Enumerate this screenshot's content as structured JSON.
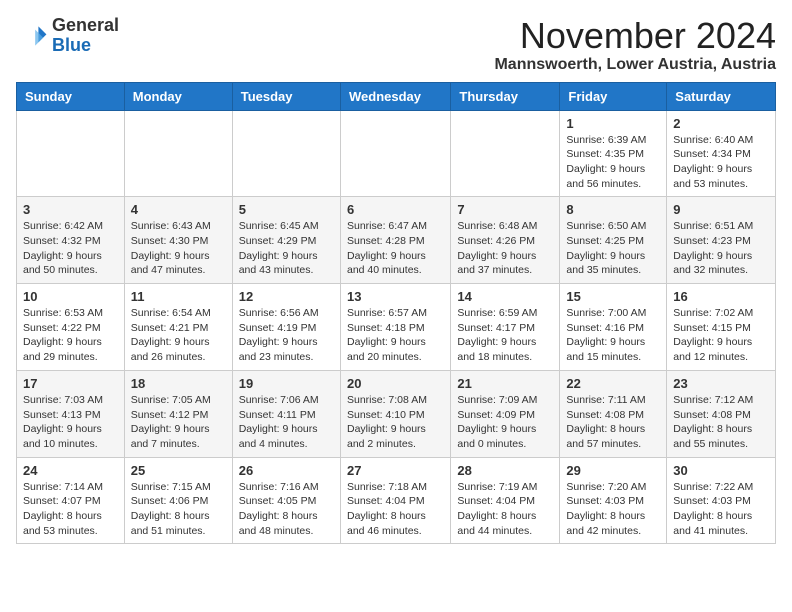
{
  "logo": {
    "general": "General",
    "blue": "Blue"
  },
  "header": {
    "month": "November 2024",
    "location": "Mannswoerth, Lower Austria, Austria"
  },
  "days_of_week": [
    "Sunday",
    "Monday",
    "Tuesday",
    "Wednesday",
    "Thursday",
    "Friday",
    "Saturday"
  ],
  "weeks": [
    [
      {
        "day": "",
        "info": ""
      },
      {
        "day": "",
        "info": ""
      },
      {
        "day": "",
        "info": ""
      },
      {
        "day": "",
        "info": ""
      },
      {
        "day": "",
        "info": ""
      },
      {
        "day": "1",
        "info": "Sunrise: 6:39 AM\nSunset: 4:35 PM\nDaylight: 9 hours and 56 minutes."
      },
      {
        "day": "2",
        "info": "Sunrise: 6:40 AM\nSunset: 4:34 PM\nDaylight: 9 hours and 53 minutes."
      }
    ],
    [
      {
        "day": "3",
        "info": "Sunrise: 6:42 AM\nSunset: 4:32 PM\nDaylight: 9 hours and 50 minutes."
      },
      {
        "day": "4",
        "info": "Sunrise: 6:43 AM\nSunset: 4:30 PM\nDaylight: 9 hours and 47 minutes."
      },
      {
        "day": "5",
        "info": "Sunrise: 6:45 AM\nSunset: 4:29 PM\nDaylight: 9 hours and 43 minutes."
      },
      {
        "day": "6",
        "info": "Sunrise: 6:47 AM\nSunset: 4:28 PM\nDaylight: 9 hours and 40 minutes."
      },
      {
        "day": "7",
        "info": "Sunrise: 6:48 AM\nSunset: 4:26 PM\nDaylight: 9 hours and 37 minutes."
      },
      {
        "day": "8",
        "info": "Sunrise: 6:50 AM\nSunset: 4:25 PM\nDaylight: 9 hours and 35 minutes."
      },
      {
        "day": "9",
        "info": "Sunrise: 6:51 AM\nSunset: 4:23 PM\nDaylight: 9 hours and 32 minutes."
      }
    ],
    [
      {
        "day": "10",
        "info": "Sunrise: 6:53 AM\nSunset: 4:22 PM\nDaylight: 9 hours and 29 minutes."
      },
      {
        "day": "11",
        "info": "Sunrise: 6:54 AM\nSunset: 4:21 PM\nDaylight: 9 hours and 26 minutes."
      },
      {
        "day": "12",
        "info": "Sunrise: 6:56 AM\nSunset: 4:19 PM\nDaylight: 9 hours and 23 minutes."
      },
      {
        "day": "13",
        "info": "Sunrise: 6:57 AM\nSunset: 4:18 PM\nDaylight: 9 hours and 20 minutes."
      },
      {
        "day": "14",
        "info": "Sunrise: 6:59 AM\nSunset: 4:17 PM\nDaylight: 9 hours and 18 minutes."
      },
      {
        "day": "15",
        "info": "Sunrise: 7:00 AM\nSunset: 4:16 PM\nDaylight: 9 hours and 15 minutes."
      },
      {
        "day": "16",
        "info": "Sunrise: 7:02 AM\nSunset: 4:15 PM\nDaylight: 9 hours and 12 minutes."
      }
    ],
    [
      {
        "day": "17",
        "info": "Sunrise: 7:03 AM\nSunset: 4:13 PM\nDaylight: 9 hours and 10 minutes."
      },
      {
        "day": "18",
        "info": "Sunrise: 7:05 AM\nSunset: 4:12 PM\nDaylight: 9 hours and 7 minutes."
      },
      {
        "day": "19",
        "info": "Sunrise: 7:06 AM\nSunset: 4:11 PM\nDaylight: 9 hours and 4 minutes."
      },
      {
        "day": "20",
        "info": "Sunrise: 7:08 AM\nSunset: 4:10 PM\nDaylight: 9 hours and 2 minutes."
      },
      {
        "day": "21",
        "info": "Sunrise: 7:09 AM\nSunset: 4:09 PM\nDaylight: 9 hours and 0 minutes."
      },
      {
        "day": "22",
        "info": "Sunrise: 7:11 AM\nSunset: 4:08 PM\nDaylight: 8 hours and 57 minutes."
      },
      {
        "day": "23",
        "info": "Sunrise: 7:12 AM\nSunset: 4:08 PM\nDaylight: 8 hours and 55 minutes."
      }
    ],
    [
      {
        "day": "24",
        "info": "Sunrise: 7:14 AM\nSunset: 4:07 PM\nDaylight: 8 hours and 53 minutes."
      },
      {
        "day": "25",
        "info": "Sunrise: 7:15 AM\nSunset: 4:06 PM\nDaylight: 8 hours and 51 minutes."
      },
      {
        "day": "26",
        "info": "Sunrise: 7:16 AM\nSunset: 4:05 PM\nDaylight: 8 hours and 48 minutes."
      },
      {
        "day": "27",
        "info": "Sunrise: 7:18 AM\nSunset: 4:04 PM\nDaylight: 8 hours and 46 minutes."
      },
      {
        "day": "28",
        "info": "Sunrise: 7:19 AM\nSunset: 4:04 PM\nDaylight: 8 hours and 44 minutes."
      },
      {
        "day": "29",
        "info": "Sunrise: 7:20 AM\nSunset: 4:03 PM\nDaylight: 8 hours and 42 minutes."
      },
      {
        "day": "30",
        "info": "Sunrise: 7:22 AM\nSunset: 4:03 PM\nDaylight: 8 hours and 41 minutes."
      }
    ]
  ]
}
